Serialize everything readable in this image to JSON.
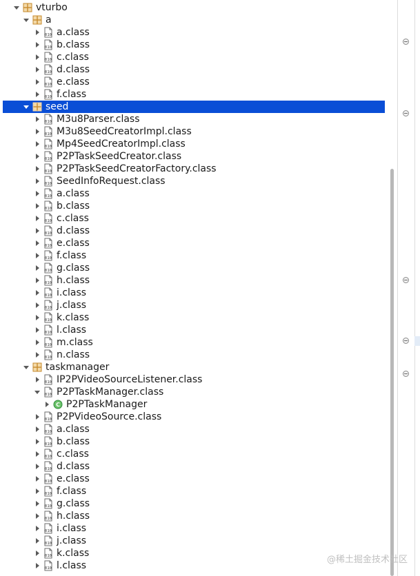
{
  "tree": [
    {
      "label": "vturbo",
      "type": "package",
      "expanded": true,
      "level": 0
    },
    {
      "label": "a",
      "type": "package",
      "expanded": true,
      "level": 1
    },
    {
      "label": "a.class",
      "type": "class",
      "expanded": false,
      "level": 2
    },
    {
      "label": "b.class",
      "type": "class",
      "expanded": false,
      "level": 2
    },
    {
      "label": "c.class",
      "type": "class",
      "expanded": false,
      "level": 2
    },
    {
      "label": "d.class",
      "type": "class",
      "expanded": false,
      "level": 2
    },
    {
      "label": "e.class",
      "type": "class",
      "expanded": false,
      "level": 2
    },
    {
      "label": "f.class",
      "type": "class",
      "expanded": false,
      "level": 2
    },
    {
      "label": "seed",
      "type": "package",
      "expanded": true,
      "level": 1,
      "selected": true
    },
    {
      "label": "M3u8Parser.class",
      "type": "class",
      "expanded": false,
      "level": 2
    },
    {
      "label": "M3u8SeedCreatorImpl.class",
      "type": "class",
      "expanded": false,
      "level": 2
    },
    {
      "label": "Mp4SeedCreatorImpl.class",
      "type": "class",
      "expanded": false,
      "level": 2
    },
    {
      "label": "P2PTaskSeedCreator.class",
      "type": "class",
      "expanded": false,
      "level": 2
    },
    {
      "label": "P2PTaskSeedCreatorFactory.class",
      "type": "class",
      "expanded": false,
      "level": 2
    },
    {
      "label": "SeedInfoRequest.class",
      "type": "class",
      "expanded": false,
      "level": 2
    },
    {
      "label": "a.class",
      "type": "class",
      "expanded": false,
      "level": 2
    },
    {
      "label": "b.class",
      "type": "class",
      "expanded": false,
      "level": 2
    },
    {
      "label": "c.class",
      "type": "class",
      "expanded": false,
      "level": 2
    },
    {
      "label": "d.class",
      "type": "class",
      "expanded": false,
      "level": 2
    },
    {
      "label": "e.class",
      "type": "class",
      "expanded": false,
      "level": 2
    },
    {
      "label": "f.class",
      "type": "class",
      "expanded": false,
      "level": 2
    },
    {
      "label": "g.class",
      "type": "class",
      "expanded": false,
      "level": 2
    },
    {
      "label": "h.class",
      "type": "class",
      "expanded": false,
      "level": 2
    },
    {
      "label": "i.class",
      "type": "class",
      "expanded": false,
      "level": 2
    },
    {
      "label": "j.class",
      "type": "class",
      "expanded": false,
      "level": 2
    },
    {
      "label": "k.class",
      "type": "class",
      "expanded": false,
      "level": 2
    },
    {
      "label": "l.class",
      "type": "class",
      "expanded": false,
      "level": 2
    },
    {
      "label": "m.class",
      "type": "class",
      "expanded": false,
      "level": 2
    },
    {
      "label": "n.class",
      "type": "class",
      "expanded": false,
      "level": 2
    },
    {
      "label": "taskmanager",
      "type": "package",
      "expanded": true,
      "level": 1
    },
    {
      "label": "IP2PVideoSourceListener.class",
      "type": "class",
      "expanded": false,
      "level": 2
    },
    {
      "label": "P2PTaskManager.class",
      "type": "class",
      "expanded": true,
      "level": 2
    },
    {
      "label": "P2PTaskManager",
      "type": "type",
      "expanded": false,
      "level": 3
    },
    {
      "label": "P2PVideoSource.class",
      "type": "class",
      "expanded": false,
      "level": 2
    },
    {
      "label": "a.class",
      "type": "class",
      "expanded": false,
      "level": 2
    },
    {
      "label": "b.class",
      "type": "class",
      "expanded": false,
      "level": 2
    },
    {
      "label": "c.class",
      "type": "class",
      "expanded": false,
      "level": 2
    },
    {
      "label": "d.class",
      "type": "class",
      "expanded": false,
      "level": 2
    },
    {
      "label": "e.class",
      "type": "class",
      "expanded": false,
      "level": 2
    },
    {
      "label": "f.class",
      "type": "class",
      "expanded": false,
      "level": 2
    },
    {
      "label": "g.class",
      "type": "class",
      "expanded": false,
      "level": 2
    },
    {
      "label": "h.class",
      "type": "class",
      "expanded": false,
      "level": 2
    },
    {
      "label": "i.class",
      "type": "class",
      "expanded": false,
      "level": 2
    },
    {
      "label": "j.class",
      "type": "class",
      "expanded": false,
      "level": 2
    },
    {
      "label": "k.class",
      "type": "class",
      "expanded": false,
      "level": 2
    },
    {
      "label": "l.class",
      "type": "class",
      "expanded": false,
      "level": 2
    }
  ],
  "colors": {
    "selection": "#0a4ed6",
    "package_icon": "#c68a2e",
    "type_icon": "#2e8b3a"
  },
  "icons": {
    "package": "package-icon",
    "class": "class-file-icon",
    "type": "class-type-icon"
  },
  "watermark": "@稀土掘金技术社区"
}
